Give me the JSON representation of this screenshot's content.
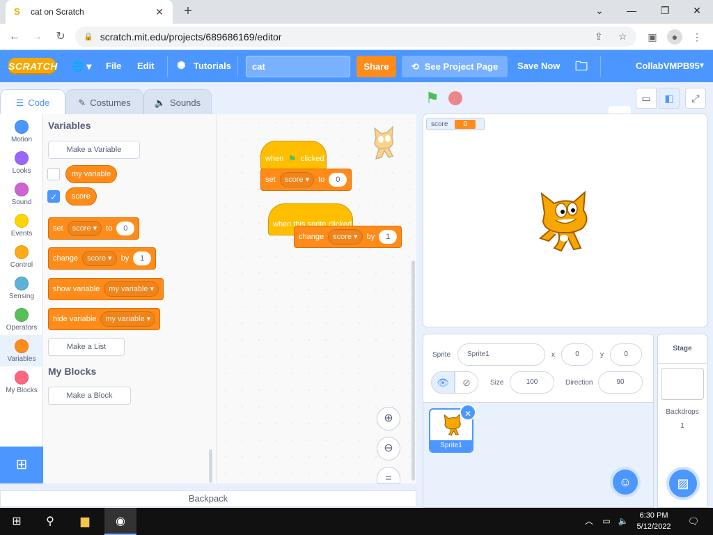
{
  "browser": {
    "tab_title": "cat on Scratch",
    "new_tab": "+",
    "url": "scratch.mit.edu/projects/689686169/editor",
    "window_controls": {
      "minimize": "⌄",
      "min": "—",
      "max": "❐",
      "close": "✕"
    }
  },
  "menubar": {
    "logo": "SCRATCH",
    "language": "🌐 ▾",
    "file": "File",
    "edit": "Edit",
    "tutorials": "Tutorials",
    "project_title": "cat",
    "share": "Share",
    "see_project_page": "See Project Page",
    "save_now": "Save Now",
    "username": "CollabVMPB95",
    "accent": "#4c97ff"
  },
  "tabs": {
    "code": "Code",
    "costumes": "Costumes",
    "sounds": "Sounds"
  },
  "categories": [
    {
      "label": "Motion",
      "color": "#4c97ff"
    },
    {
      "label": "Looks",
      "color": "#9966ff"
    },
    {
      "label": "Sound",
      "color": "#cf63cf"
    },
    {
      "label": "Events",
      "color": "#ffd500"
    },
    {
      "label": "Control",
      "color": "#ffab19"
    },
    {
      "label": "Sensing",
      "color": "#5cb1d6"
    },
    {
      "label": "Operators",
      "color": "#59c059"
    },
    {
      "label": "Variables",
      "color": "#ff8c1a"
    },
    {
      "label": "My Blocks",
      "color": "#ff6680"
    }
  ],
  "palette": {
    "variables_heading": "Variables",
    "make_variable": "Make a Variable",
    "var1": "my variable",
    "var2": "score",
    "set_block": {
      "a": "set",
      "dd": "score",
      "b": "to",
      "val": "0"
    },
    "change_block": {
      "a": "change",
      "dd": "score",
      "b": "by",
      "val": "1"
    },
    "show_block": {
      "a": "show variable",
      "dd": "my variable"
    },
    "hide_block": {
      "a": "hide variable",
      "dd": "my variable"
    },
    "make_list": "Make a List",
    "myblocks_heading": "My Blocks",
    "make_block": "Make a Block"
  },
  "script": {
    "hat1": {
      "a": "when",
      "b": "clicked"
    },
    "set1": {
      "a": "set",
      "dd": "score",
      "b": "to",
      "val": "0"
    },
    "hat2": "when this sprite clicked",
    "change1": {
      "a": "change",
      "dd": "score",
      "b": "by",
      "val": "1"
    },
    "backpack": "Backpack"
  },
  "stage": {
    "monitor_label": "score",
    "monitor_value": "0"
  },
  "sprite": {
    "sprite_label": "Sprite",
    "name": "Sprite1",
    "x_label": "x",
    "x": "0",
    "y_label": "y",
    "y": "0",
    "size_label": "Size",
    "size": "100",
    "direction_label": "Direction",
    "direction": "90",
    "thumb_name": "Sprite1"
  },
  "stage_pane": {
    "title": "Stage",
    "backdrops_label": "Backdrops",
    "backdrops_count": "1"
  },
  "taskbar": {
    "time": "6:30 PM",
    "date": "5/12/2022"
  }
}
